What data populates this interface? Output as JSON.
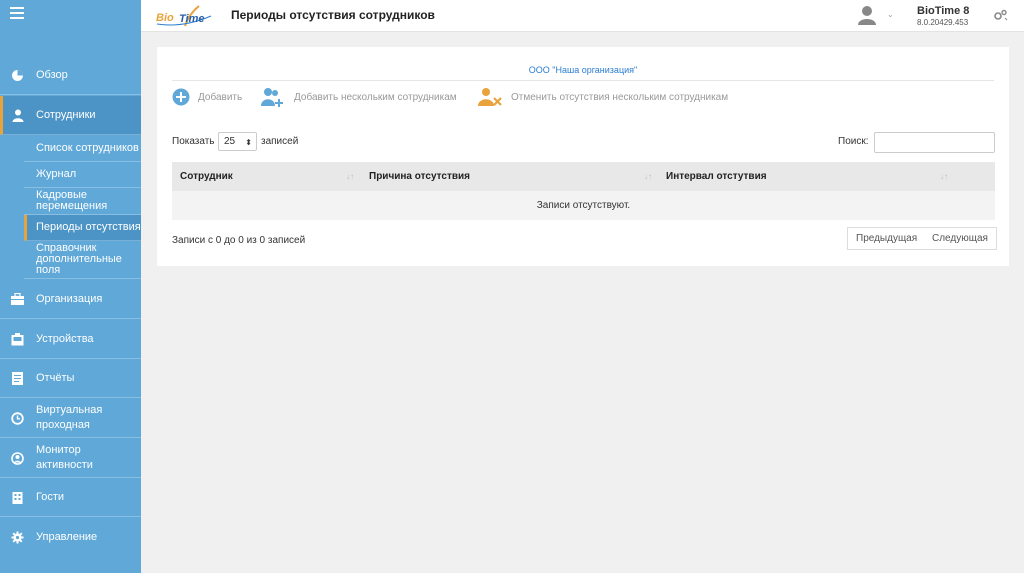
{
  "brand": {
    "logo_text_a": "Bio",
    "logo_text_b": "Time",
    "app_name": "BioTime 8",
    "app_version": "8.0.20429.453"
  },
  "header": {
    "title": "Периоды отсутствия сотрудников"
  },
  "sidebar": {
    "items": [
      {
        "label": "Обзор",
        "icon": "pie-chart-icon"
      },
      {
        "label": "Сотрудники",
        "icon": "user-icon"
      },
      {
        "label": "Организация",
        "icon": "briefcase-icon"
      },
      {
        "label": "Устройства",
        "icon": "device-icon"
      },
      {
        "label": "Отчёты",
        "icon": "report-icon"
      },
      {
        "label": "Виртуальная проходная",
        "icon": "clock-icon"
      },
      {
        "label": "Монитор активности",
        "icon": "monitor-user-icon"
      },
      {
        "label": "Гости",
        "icon": "building-icon"
      },
      {
        "label": "Управление",
        "icon": "gear-icon"
      }
    ],
    "sub_items": [
      {
        "label": "Список сотрудников"
      },
      {
        "label": "Журнал"
      },
      {
        "label": "Кадровые перемещения"
      },
      {
        "label": "Периоды отсутствия"
      },
      {
        "label": "Справочник дополнительные поля"
      }
    ]
  },
  "content": {
    "org_name": "ООО \"Наша организация\"",
    "toolbar": {
      "add": "Добавить",
      "add_multiple": "Добавить нескольким сотрудникам",
      "cancel_multiple": "Отменить отсутствия нескольким сотрудникам"
    },
    "show_label": "Показать",
    "page_size": "25",
    "records_label": "записей",
    "search_label": "Поиск:",
    "search_value": "",
    "columns": [
      "Сотрудник",
      "Причина отсутствия",
      "Интервал отстутвия"
    ],
    "empty_text": "Записи отсутствуют.",
    "info_text": "Записи с 0 до 0 из 0 записей",
    "prev_label": "Предыдущая",
    "next_label": "Следующая"
  },
  "colors": {
    "sidebar": "#5fa8d8",
    "accent": "#e8a33d",
    "link": "#2a7dd1"
  }
}
